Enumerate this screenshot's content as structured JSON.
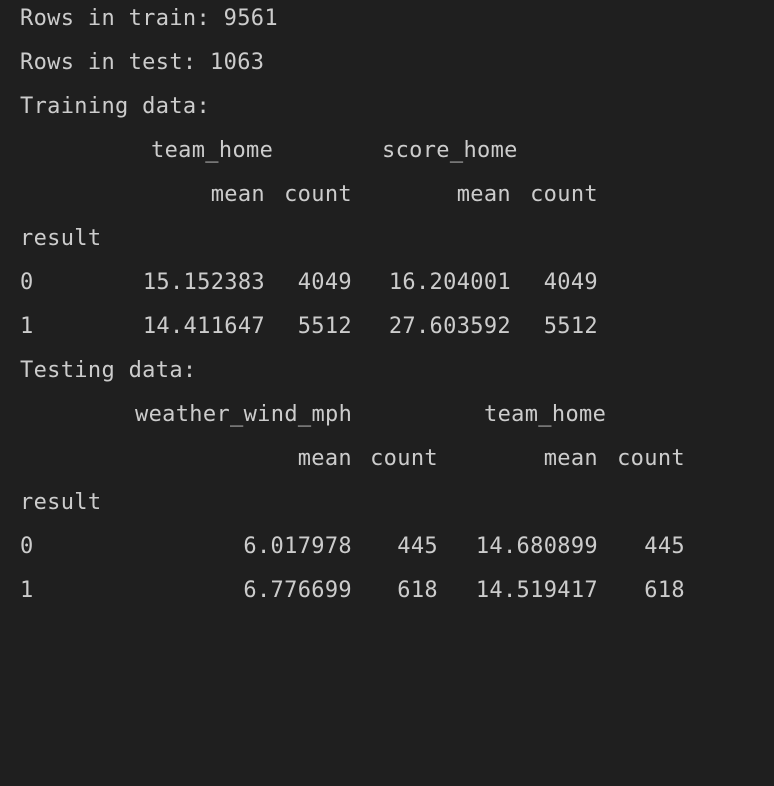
{
  "output": {
    "train_rows_line": "Rows in train: 9561",
    "test_rows_line": "Rows in test: 1063",
    "training": {
      "heading": "Training data:",
      "top_headers": [
        "team_home",
        "score_home"
      ],
      "sub_headers": [
        "mean",
        "count",
        "mean",
        "count"
      ],
      "index_name": "result",
      "rows": [
        {
          "index": "0",
          "values": [
            "15.152383",
            "4049",
            "16.204001",
            "4049"
          ]
        },
        {
          "index": "1",
          "values": [
            "14.411647",
            "5512",
            "27.603592",
            "5512"
          ]
        }
      ]
    },
    "testing": {
      "heading": "Testing data:",
      "top_headers": [
        "weather_wind_mph",
        "team_home"
      ],
      "sub_headers": [
        "mean",
        "count",
        "mean",
        "count"
      ],
      "index_name": "result",
      "rows": [
        {
          "index": "0",
          "values": [
            "6.017978",
            "445",
            "14.680899",
            "445"
          ]
        },
        {
          "index": "1",
          "values": [
            "6.776699",
            "618",
            "14.519417",
            "618"
          ]
        }
      ]
    }
  }
}
